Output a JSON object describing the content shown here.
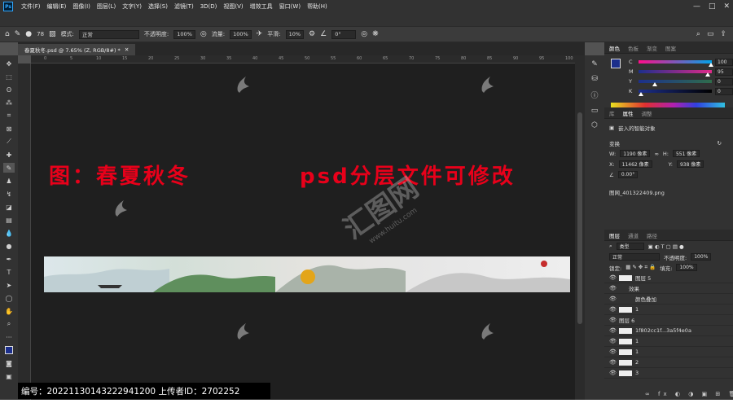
{
  "app": {
    "logo": "Ps"
  },
  "menubar": {
    "items": [
      "文件(F)",
      "编辑(E)",
      "图像(I)",
      "图层(L)",
      "文字(Y)",
      "选择(S)",
      "滤镜(T)",
      "3D(D)",
      "视图(V)",
      "增效工具",
      "窗口(W)",
      "帮助(H)"
    ]
  },
  "options": {
    "brush_size": "78",
    "mode_label": "模式:",
    "mode_value": "正常",
    "opacity_label": "不透明度:",
    "opacity_value": "100%",
    "flow_label": "流量:",
    "flow_value": "100%",
    "smooth_label": "平滑:",
    "smooth_value": "10%",
    "angle_value": "0°"
  },
  "document": {
    "tab_title": "春夏秋冬.psd @ 7.65% (Z, RGB/8#) *"
  },
  "ruler_h": [
    "0",
    "5",
    "10",
    "15",
    "20",
    "25",
    "30",
    "35",
    "40",
    "45",
    "50",
    "55",
    "60",
    "65",
    "70",
    "75",
    "80",
    "85",
    "90",
    "95",
    "100"
  ],
  "canvas": {
    "headline_left": "图：春夏秋冬",
    "headline_right": "psd分层文件可修改",
    "center_brand": "汇图网",
    "center_url": "www.huitu.com"
  },
  "color_panel": {
    "tabs": [
      "颜色",
      "色板",
      "渐变",
      "图案"
    ],
    "channels": [
      {
        "key": "C",
        "value": "100",
        "unit": "%",
        "level": 1.0
      },
      {
        "key": "M",
        "value": "95",
        "unit": "%",
        "level": 0.95
      },
      {
        "key": "Y",
        "value": "0",
        "unit": "%",
        "level": 0.2
      },
      {
        "key": "K",
        "value": "0",
        "unit": "%",
        "level": 0.0
      }
    ],
    "foreground": "#1c2f8c"
  },
  "properties_panel": {
    "tabs": [
      "库",
      "属性",
      "调整"
    ],
    "object_type": "嵌入的智能对象",
    "transform_label": "变换",
    "w_label": "W:",
    "w_value": "1190 像素",
    "h_label": "H:",
    "h_value": "551 像素",
    "x_label": "X:",
    "x_value": "11462 像素",
    "y_label": "Y:",
    "y_value": "938 像素",
    "angle_value": "0.00°",
    "file_name": "图网_401322409.png"
  },
  "layers_panel": {
    "tabs": [
      "图层",
      "通道",
      "路径"
    ],
    "filter_label": "类型",
    "blend_mode": "正常",
    "opacity_label": "不透明度:",
    "opacity_value": "100%",
    "lock_label": "锁定:",
    "fill_label": "填充:",
    "fill_value": "100%",
    "layers": [
      {
        "name": "图层 5"
      },
      {
        "name": "效果"
      },
      {
        "name": "颜色叠加"
      },
      {
        "name": "1"
      },
      {
        "name": "图层 6"
      },
      {
        "name": "1f802cc1f...3a5f4e0a"
      },
      {
        "name": "1"
      },
      {
        "name": "1"
      },
      {
        "name": "2"
      },
      {
        "name": "3"
      }
    ]
  },
  "footer": {
    "text": "编号：20221130143222941200 上传者ID：2702252"
  },
  "colors": {
    "headline": "#e8001a",
    "bg_dark": "#1f1f1f",
    "panel": "#323232"
  }
}
